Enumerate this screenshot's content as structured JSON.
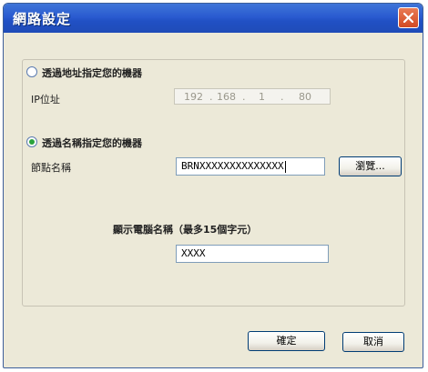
{
  "window": {
    "title": "網路設定"
  },
  "option_address": {
    "label": "透過地址指定您的機器",
    "selected": false
  },
  "ip": {
    "label": "IP位址",
    "octets": [
      "192",
      "168",
      "1",
      "80"
    ],
    "separators": [
      ".",
      ".",
      "."
    ]
  },
  "option_name": {
    "label": "透過名稱指定您的機器",
    "selected": true
  },
  "node": {
    "label": "節點名稱",
    "value": "BRNXXXXXXXXXXXXXX",
    "browse_label": "瀏覽..."
  },
  "display": {
    "label": "顯示電腦名稱（最多15個字元）",
    "value": "XXXX"
  },
  "buttons": {
    "ok_label": "確定",
    "cancel_label": "取消"
  }
}
